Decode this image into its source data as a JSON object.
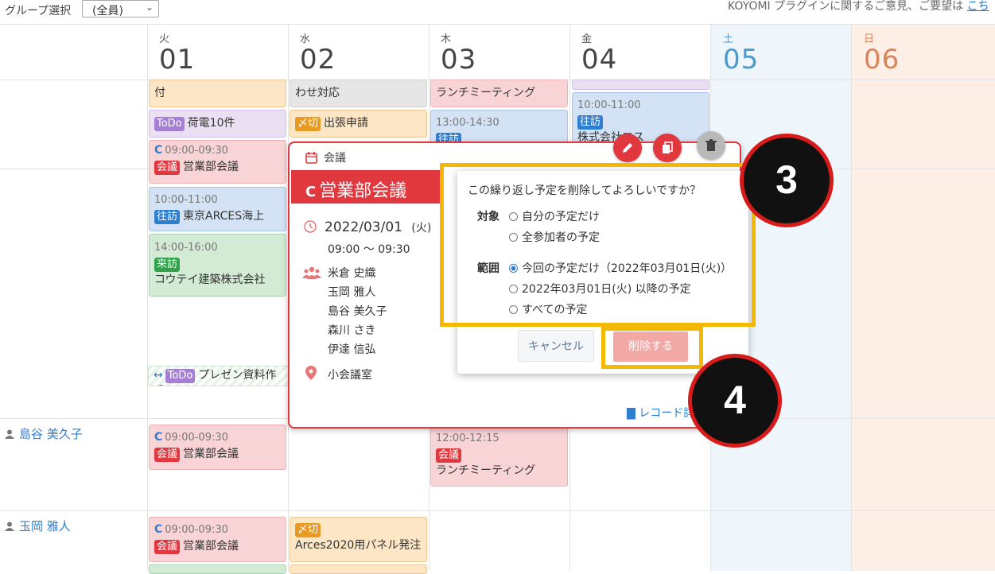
{
  "topbar": {
    "group_label": "グループ選択",
    "group_value": "(全員)",
    "notice_text": "KOYOMI プラグインに関するご意見、ご要望は",
    "notice_link": "こち"
  },
  "days": [
    {
      "dow": "火",
      "num": "01"
    },
    {
      "dow": "水",
      "num": "02"
    },
    {
      "dow": "木",
      "num": "03"
    },
    {
      "dow": "金",
      "num": "04"
    },
    {
      "dow": "土",
      "num": "05"
    },
    {
      "dow": "日",
      "num": "06"
    }
  ],
  "events": {
    "tue_1": "付",
    "tue_2_tag": "ToDo",
    "tue_2_text": "荷電10件",
    "tue_3_time": "09:00-09:30",
    "tue_3_tag": "会議",
    "tue_3_text": "営業部会議",
    "tue_4_time": "10:00-11:00",
    "tue_4_tag": "往訪",
    "tue_4_text": "東京ARCES海上",
    "tue_5_time": "14:00-16:00",
    "tue_5_tag": "来訪",
    "tue_5_text": "コウテイ建築株式会社",
    "wed_1": "わせ対応",
    "wed_2_tag": "〆切",
    "wed_2_text": "出張申請",
    "thu_1": "ランチミーティング",
    "thu_2_time": "13:00-14:30",
    "thu_2_tag": "往訪",
    "fri_2_time": "10:00-11:00",
    "fri_2_tag": "往訪",
    "fri_2_text": "株式会社エス",
    "span_tag": "ToDo",
    "span_text": "プレゼン資料作成"
  },
  "people": [
    {
      "name": "島谷 美久子",
      "tue_time": "09:00-09:30",
      "tue_tag": "会議",
      "tue_text": "営業部会議",
      "thu_time": "12:00-12:15",
      "thu_tag": "会議",
      "thu_text": "ランチミーティング"
    },
    {
      "name": "玉岡 雅人",
      "tue_time": "09:00-09:30",
      "tue_tag": "会議",
      "tue_text": "営業部会議",
      "wed_tag": "〆切",
      "wed_text": "Arces2020用パネル発注"
    }
  ],
  "popup": {
    "category": "会議",
    "title": "営業部会議",
    "date": "2022/03/01",
    "weekday": "(火)",
    "time": "09:00 ～ 09:30",
    "attendees": [
      "米倉 史織",
      "玉岡 雅人",
      "島谷 美久子",
      "森川 さき",
      "伊達 信弘"
    ],
    "location": "小会議室",
    "record_link": "レコード詳"
  },
  "confirm": {
    "question": "この繰り返し予定を削除してよろしいですか？",
    "target_label": "対象",
    "target_options": [
      "自分の予定だけ",
      "全参加者の予定"
    ],
    "range_label": "範囲",
    "range_options": [
      "今回の予定だけ（2022年03月01日(火)）",
      "2022年03月01日(火) 以降の予定",
      "すべての予定"
    ],
    "cancel": "キャンセル",
    "delete": "削除する"
  },
  "annotations": {
    "step3": "3",
    "step4": "4"
  },
  "colors": {
    "accent_red": "#e0383e",
    "highlight": "#f5b800",
    "link_blue": "#2e7fd2"
  },
  "icons": [
    "calendar-icon",
    "repeat-icon",
    "clock-icon",
    "people-icon",
    "location-icon",
    "document-icon",
    "pencil-icon",
    "copy-icon",
    "trash-icon",
    "person-icon",
    "chevron-down-icon"
  ]
}
